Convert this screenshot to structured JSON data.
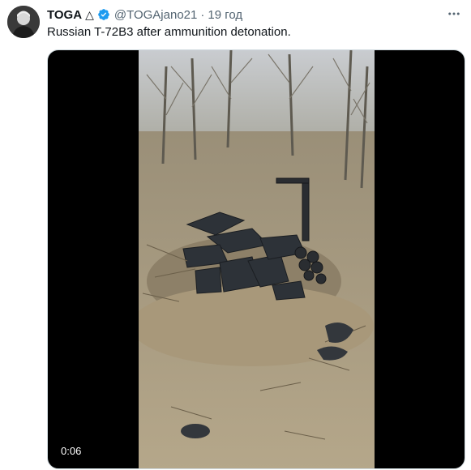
{
  "tweet": {
    "display_name": "TOGA",
    "name_glyph": "△",
    "verified_icon": "verified-badge-icon",
    "handle": "@TOGAjano21",
    "separator": "·",
    "time": "19 год",
    "more_icon": "more-options-icon",
    "text": "Russian T-72B3 after ammunition detonation.",
    "media": {
      "duration": "0:06"
    }
  },
  "colors": {
    "verified": "#1d9bf0",
    "secondary_text": "#536471",
    "primary_text": "#0f1419"
  }
}
